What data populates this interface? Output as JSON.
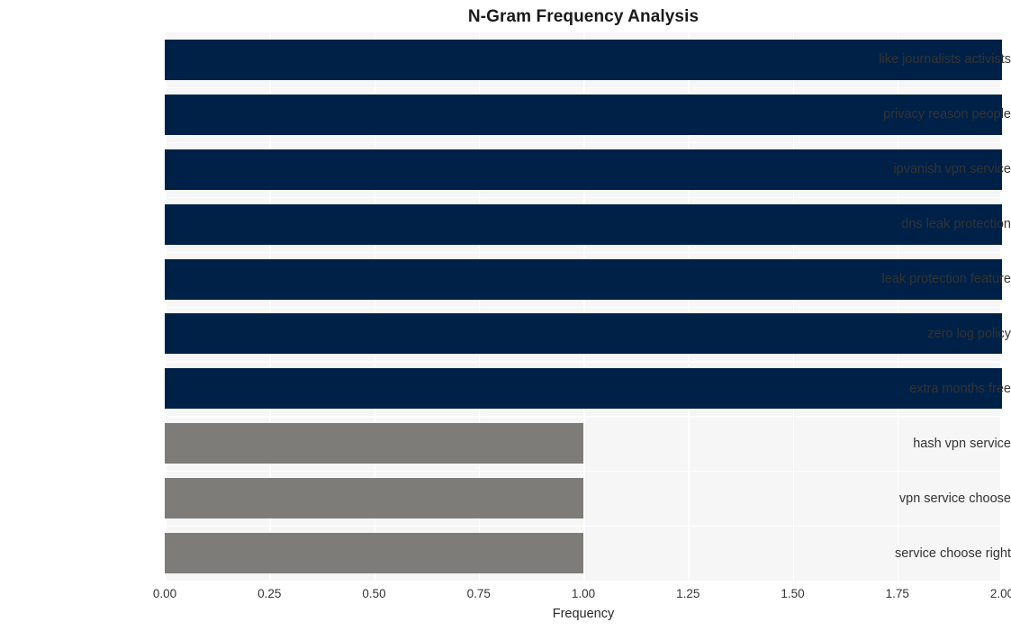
{
  "chart_data": {
    "type": "bar",
    "orientation": "horizontal",
    "title": "N-Gram Frequency Analysis",
    "xlabel": "Frequency",
    "ylabel": "",
    "xlim": [
      0,
      2
    ],
    "grid": true,
    "legend": "none",
    "xticks": [
      "0.00",
      "0.25",
      "0.50",
      "0.75",
      "1.00",
      "1.25",
      "1.50",
      "1.75",
      "2.00"
    ],
    "xtick_values": [
      0,
      0.25,
      0.5,
      0.75,
      1.0,
      1.25,
      1.5,
      1.75,
      2.0
    ],
    "categories": [
      "like journalists activists",
      "privacy reason people",
      "ipvanish vpn service",
      "dns leak protection",
      "leak protection feature",
      "zero log policy",
      "extra months free",
      "hash vpn service",
      "vpn service choose",
      "service choose right"
    ],
    "values": [
      2,
      2,
      2,
      2,
      2,
      2,
      2,
      1,
      1,
      1
    ],
    "bar_colors": [
      "#002147",
      "#002147",
      "#002147",
      "#002147",
      "#002147",
      "#002147",
      "#002147",
      "#7d7c79",
      "#7d7c79",
      "#7d7c79"
    ],
    "colors": {
      "primary_bar": "#002147",
      "secondary_bar": "#7d7c79",
      "plot_background": "#f6f6f7",
      "grid": "#ffffff",
      "figure_background": "#ffffff",
      "text": "#333333"
    }
  }
}
